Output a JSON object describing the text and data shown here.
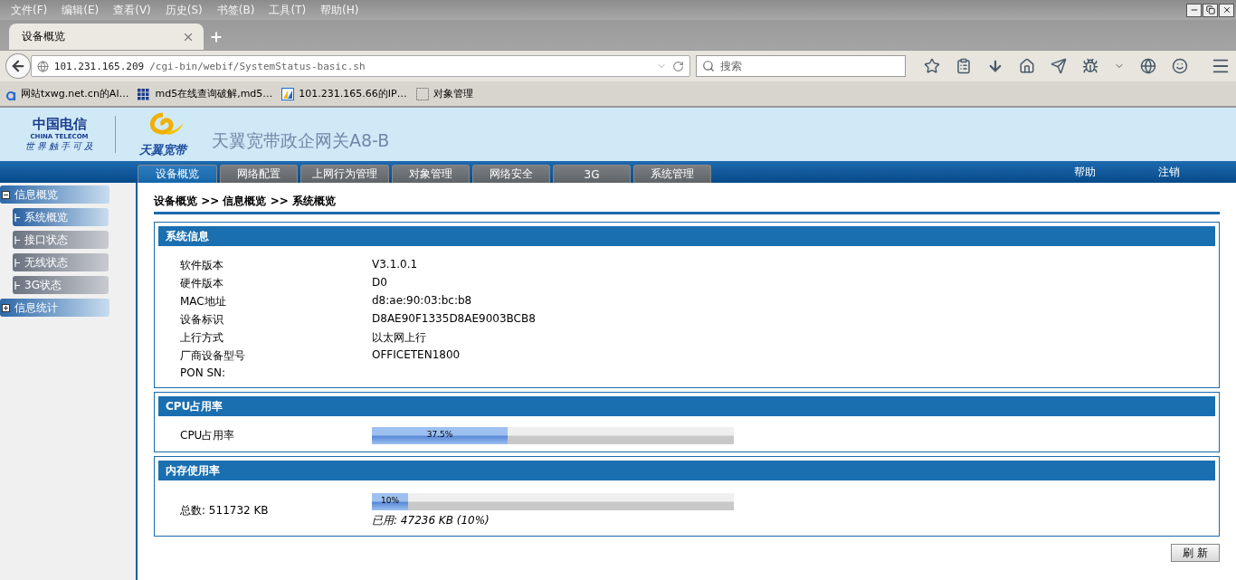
{
  "browser": {
    "menu": [
      {
        "label": "文件(F)"
      },
      {
        "label": "编辑(E)"
      },
      {
        "label": "查看(V)"
      },
      {
        "label": "历史(S)"
      },
      {
        "label": "书签(B)"
      },
      {
        "label": "工具(T)"
      },
      {
        "label": "帮助(H)"
      }
    ],
    "tabs": [
      {
        "title": "设备概览",
        "selected": true
      }
    ],
    "url": {
      "host": "101.231.165.209",
      "path": "/cgi-bin/webif/SystemStatus-basic.sh"
    },
    "search": {
      "placeholder": "搜索"
    },
    "bookmarks": [
      {
        "label": "网站txwg.net.cn的Al…",
        "kind": "a"
      },
      {
        "label": "md5在线查询破解,md5…",
        "kind": "grid"
      },
      {
        "label": "101.231.165.66的IP…",
        "kind": "flag"
      },
      {
        "label": "对象管理",
        "kind": "blank"
      }
    ]
  },
  "header": {
    "logo_cn": "中国电信",
    "logo_en": "CHINA TELECOM",
    "slogan": "世 界 触 手 可 及",
    "brand": "天翼宽带",
    "title": "天翼宽带政企网关A8-B"
  },
  "nav": [
    {
      "label": "设备概览",
      "selected": true
    },
    {
      "label": "网络配置",
      "selected": false
    },
    {
      "label": "上网行为管理",
      "selected": false
    },
    {
      "label": "对象管理",
      "selected": false
    },
    {
      "label": "网络安全",
      "selected": false
    },
    {
      "label": "3G",
      "selected": false
    },
    {
      "label": "系统管理",
      "selected": false
    }
  ],
  "nav_links": [
    "帮助",
    "注销"
  ],
  "sidebar": [
    {
      "label": "信息概览",
      "expanded": true,
      "children": [
        {
          "label": "系统概览",
          "selected": true
        },
        {
          "label": "接口状态",
          "selected": false
        },
        {
          "label": "无线状态",
          "selected": false
        },
        {
          "label": "3G状态",
          "selected": false
        }
      ]
    },
    {
      "label": "信息统计",
      "expanded": false
    }
  ],
  "breadcrumb": "设备概览 >> 信息概览 >> 系统概览",
  "system_info": {
    "title": "系统信息",
    "rows": [
      {
        "label": "软件版本",
        "value": "V3.1.0.1"
      },
      {
        "label": "硬件版本",
        "value": "D0"
      },
      {
        "label": "MAC地址",
        "value": "d8:ae:90:03:bc:b8"
      },
      {
        "label": "设备标识",
        "value": "D8AE90F1335D8AE9003BCB8"
      },
      {
        "label": "上行方式",
        "value": "以太网上行"
      },
      {
        "label": "厂商设备型号",
        "value": "OFFICETEN1800"
      },
      {
        "label": "PON SN:"
      }
    ]
  },
  "cpu": {
    "title": "CPU占用率",
    "label": "CPU占用率",
    "level": 0.375,
    "reading": "37.5%"
  },
  "memory": {
    "title": "内存使用率",
    "label": "总数: 511732 KB",
    "level": 0.1,
    "reading": "10%",
    "used": "已用: 47236 KB (10%)"
  },
  "refresh_button": "刷 新"
}
